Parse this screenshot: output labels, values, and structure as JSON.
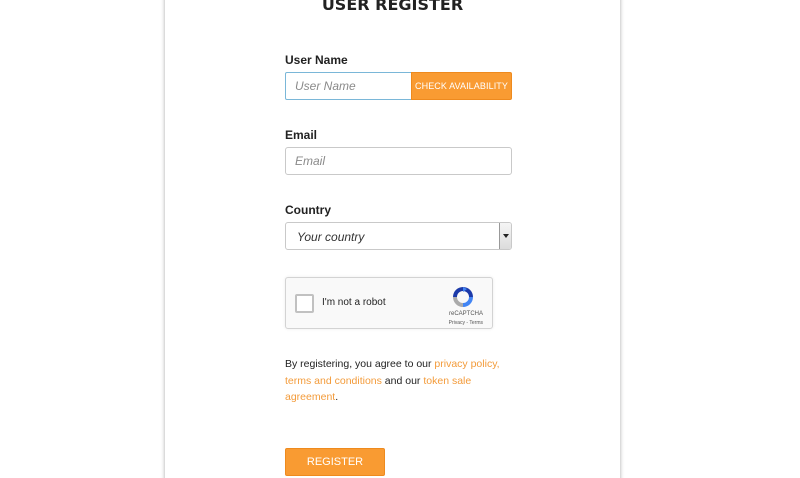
{
  "form": {
    "title": "USER REGISTER",
    "username": {
      "label": "User Name",
      "value": "",
      "placeholder": "User Name",
      "check_button": "CHECK AVAILABILITY"
    },
    "email": {
      "label": "Email",
      "value": "",
      "placeholder": "Email"
    },
    "country": {
      "label": "Country",
      "selected": "Your country"
    },
    "recaptcha": {
      "label": "I'm not a robot",
      "brand": "reCAPTCHA",
      "privacy": "Privacy",
      "separator": " - ",
      "terms": "Terms"
    },
    "agreement": {
      "prefix": "By registering, you agree to our ",
      "privacy_link": "privacy policy,",
      "space1": " ",
      "terms_link": "terms and conditions",
      "middle": " and our ",
      "sale_link": "token sale agreement",
      "suffix": "."
    },
    "register_button": "REGISTER"
  },
  "colors": {
    "accent": "#f99b32",
    "link": "#f39b3a",
    "focus_border": "#7ab7d8"
  }
}
